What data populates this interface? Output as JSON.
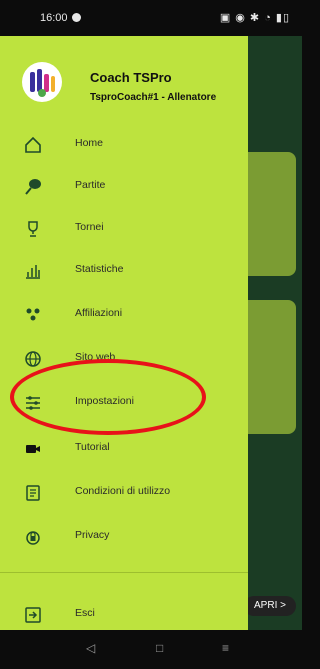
{
  "status_bar": {
    "time": "16:00",
    "icons": "▣ ◉ ✱ ◔ ▮▯"
  },
  "background": {
    "apri_label": "APRI >"
  },
  "drawer": {
    "user_name": "Coach TSPro",
    "user_role": "TsproCoach#1 - Allenatore",
    "items": [
      {
        "label": "Home",
        "icon": "home-icon"
      },
      {
        "label": "Partite",
        "icon": "tennis-racket-icon"
      },
      {
        "label": "Tornei",
        "icon": "trophy-icon"
      },
      {
        "label": "Statistiche",
        "icon": "bar-chart-icon"
      },
      {
        "label": "Affiliazioni",
        "icon": "people-icon"
      },
      {
        "label": "Sito web",
        "icon": "globe-icon"
      },
      {
        "label": "Impostazioni",
        "icon": "sliders-icon"
      },
      {
        "label": "Tutorial",
        "icon": "video-camera-icon"
      },
      {
        "label": "Condizioni di utilizzo",
        "icon": "document-icon"
      },
      {
        "label": "Privacy",
        "icon": "lock-icon"
      }
    ],
    "logout": {
      "label": "Esci",
      "icon": "logout-icon"
    }
  },
  "nav_bar": {
    "back": "◁",
    "home": "□",
    "recents": "≡"
  },
  "colors": {
    "drawer": "#bde33e",
    "highlight": "#e81219",
    "background": "#1b3c24"
  }
}
